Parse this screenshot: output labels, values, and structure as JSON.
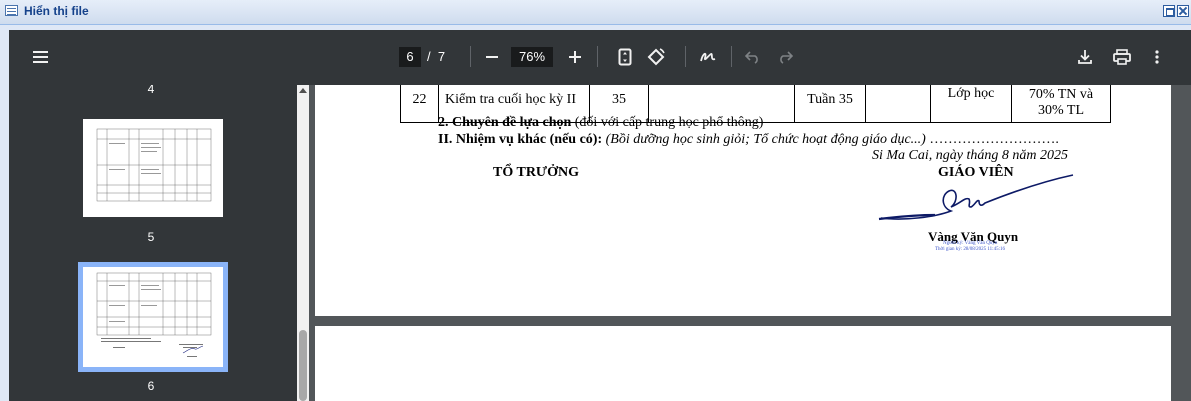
{
  "window": {
    "title": "Hiển thị file"
  },
  "toolbar": {
    "current_page": "6",
    "page_separator": "/",
    "total_pages": "7",
    "zoom": "76%",
    "icons": [
      "menu-icon",
      "zoom-out-icon",
      "zoom-in-icon",
      "fit-page-icon",
      "rotate-icon",
      "annotate-icon",
      "undo-icon",
      "redo-icon",
      "download-icon",
      "print-icon",
      "more-icon"
    ]
  },
  "sidebar": {
    "thumbnails": [
      {
        "label": "4"
      },
      {
        "label": "5"
      },
      {
        "label": "6",
        "selected": true
      }
    ]
  },
  "document": {
    "table_row": {
      "number": "22",
      "content": "Kiểm tra cuối học kỳ II",
      "periods": "35",
      "blank1": "",
      "week": "Tuần 35",
      "blank2": "",
      "location": "Lớp học",
      "ratio_line1": "70% TN và",
      "ratio_line2": "30% TL"
    },
    "section2_bold": "2. Chuyên đề lựa chọn",
    "section2_rest": " (đối với cấp trung học phổ thông)",
    "sectionII_bold": "II. Nhiệm vụ khác (nếu có):",
    "sectionII_italic": " (Bồi dưỡng học sinh giỏi; Tổ chức hoạt động giáo dục...)",
    "sectionII_dots": " ……………………….",
    "place_date": "Si Ma Cai, ngày    tháng 8 năm 2025",
    "left_signer_title": "TỔ TRƯỞNG",
    "right_signer_title": "GIÁO VIÊN",
    "teacher_name": "Vàng Văn Quyn",
    "stamp_line1": "Người ký: Vàng Văn Quyn",
    "stamp_line2": "Thời gian ký: 28/08/2025 11:45:16"
  }
}
